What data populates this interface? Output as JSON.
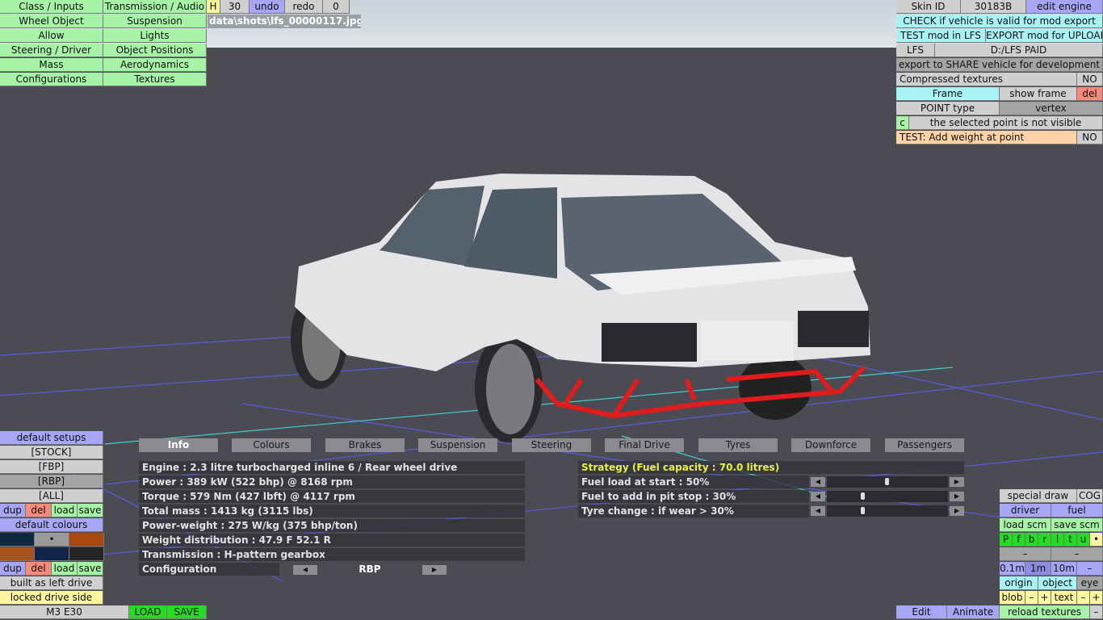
{
  "menu_left": [
    "Class / Inputs",
    "Wheel Object",
    "Allow",
    "Steering / Driver",
    "Mass",
    "Configurations"
  ],
  "menu_right": [
    "Transmission / Audio",
    "Suspension",
    "Lights",
    "Object Positions",
    "Aerodynamics",
    "Textures"
  ],
  "toolbar": {
    "h": "H",
    "count": "30",
    "undo": "undo",
    "redo": "redo",
    "zero": "0"
  },
  "filename": "data\\shots\\lfs_00000117.jpg",
  "right_panel": {
    "skin_id_label": "Skin ID",
    "skin_id": "30183B",
    "edit_engine": "edit engine",
    "check": "CHECK if vehicle is valid for mod export",
    "test_mod": "TEST mod in LFS",
    "export_mod": "EXPORT mod for UPLOAD",
    "lfs": "LFS",
    "path": "D:/LFS PAID",
    "export_share": "export to SHARE vehicle for development",
    "compressed": "Compressed textures",
    "compressed_val": "NO",
    "frame": "Frame",
    "show_frame": "show frame",
    "del": "del",
    "point_type": "POINT type",
    "point_val": "vertex",
    "c": "c",
    "not_visible": "the selected point is not visible",
    "test_weight": "TEST: Add weight at point",
    "test_weight_val": "NO"
  },
  "setups": {
    "title": "default setups",
    "items": [
      "[STOCK]",
      "[FBP]",
      "[RBP]",
      "[ALL]"
    ],
    "selected": "[RBP]",
    "dup": "dup",
    "del": "del",
    "load": "load",
    "save": "save",
    "colours": "default colours",
    "swatches": [
      "#0f2a40",
      "#9a9a9a",
      "#a8480f",
      "#a8541e",
      "#12244a",
      "#262626"
    ],
    "left_drive": "built as left drive",
    "locked": "locked drive side"
  },
  "bottom_bar": {
    "car": "M3 E30",
    "load": "LOAD",
    "save": "SAVE",
    "edit": "Edit",
    "animate": "Animate",
    "reload": "reload textures",
    "minus": "–"
  },
  "tools": {
    "special": "special draw",
    "cog": "COG",
    "driver": "driver",
    "fuel": "fuel",
    "load_scm": "load scm",
    "save_scm": "save scm",
    "letters": [
      "P",
      "f",
      "b",
      "r",
      "l",
      "t",
      "u",
      "•"
    ],
    "dash": "–",
    "scales": [
      "0.1m",
      "1m",
      "10m",
      "–"
    ],
    "origin": "origin",
    "object": "object",
    "eye": "eye",
    "blob": "blob",
    "minus": "–",
    "plus": "+",
    "text": "text"
  },
  "tabs": [
    "Info",
    "Colours",
    "Brakes",
    "Suspension",
    "Steering",
    "Final Drive",
    "Tyres",
    "Downforce",
    "Passengers"
  ],
  "active_tab": "Info",
  "info": [
    "Engine : 2.3 litre turbocharged inline 6 / Rear wheel drive",
    "Power : 389 kW (522 bhp) @ 8168 rpm",
    "Torque : 579 Nm (427 lbft) @ 4117 rpm",
    "Total mass : 1413 kg (3115 lbs)",
    "Power-weight : 275 W/kg (375 bhp/ton)",
    "Weight distribution : 47.9 F  52.1 R",
    "Transmission : H-pattern gearbox"
  ],
  "configuration": {
    "label": "Configuration",
    "value": "RBP"
  },
  "strategy": {
    "title": "Strategy (Fuel capacity : 70.0 litres)",
    "rows": [
      {
        "label": "Fuel load at start : 50%",
        "value": 50
      },
      {
        "label": "Fuel to add in pit stop : 30%",
        "value": 30
      },
      {
        "label": "Tyre change : if wear > 30%",
        "value": 30
      }
    ]
  }
}
